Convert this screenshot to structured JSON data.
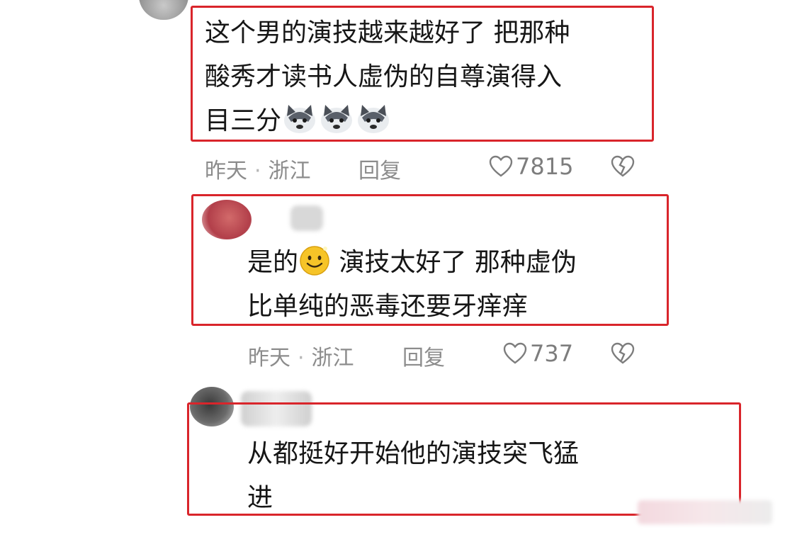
{
  "comments": [
    {
      "lines": [
        "这个男的演技越来越好了 把那种",
        "酸秀才读书人虚伪的自尊演得入",
        "目三分"
      ],
      "emoji": "husky-dog",
      "time": "昨天",
      "location": "浙江",
      "reply_label": "回复",
      "likes": "7815"
    },
    {
      "lines_1a": "是的",
      "lines_1b": " 演技太好了 那种虚伪",
      "lines_2": "比单纯的恶毒还要牙痒痒",
      "emoji": "smiley-face",
      "time": "昨天",
      "location": "浙江",
      "reply_label": "回复",
      "likes": "737"
    },
    {
      "lines": [
        "从都挺好开始他的演技突飞猛",
        "进"
      ]
    }
  ],
  "separator": "·",
  "icons": {
    "like": "heart-outline-icon",
    "dislike": "broken-heart-icon"
  },
  "colors": {
    "highlight": "#d9252b",
    "meta": "#8c8c8c"
  }
}
